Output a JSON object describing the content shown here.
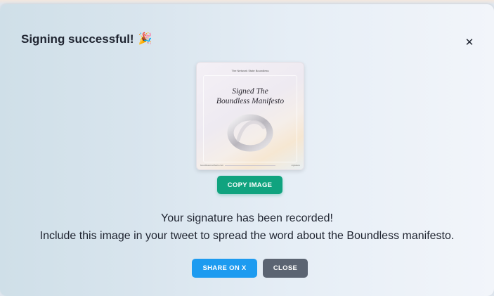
{
  "dialog": {
    "title": "Signing successful!",
    "title_icon": "party-popper-icon",
    "title_emoji": "🎉",
    "close_symbol": "✕"
  },
  "card": {
    "header": "The Network State Boundless",
    "title_line1": "Signed The",
    "title_line2": "Boundless Manifesto",
    "footer_left": "boundlessmanifesto.com",
    "footer_right": "signature"
  },
  "buttons": {
    "copy_image": "COPY IMAGE",
    "share_on_x": "SHARE ON X",
    "close": "CLOSE"
  },
  "messages": {
    "line1": "Your signature has been recorded!",
    "line2": "Include this image in your tweet to spread the word about the Boundless manifesto."
  },
  "colors": {
    "copy_button": "#10a37f",
    "share_button": "#1d9bf0",
    "close_button": "#5b6472"
  }
}
